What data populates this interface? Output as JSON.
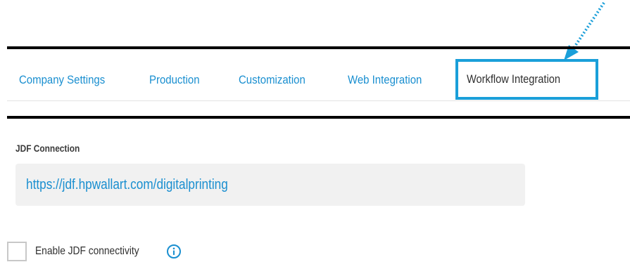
{
  "tabs": [
    {
      "label": "Company Settings",
      "active": false
    },
    {
      "label": "Production",
      "active": false
    },
    {
      "label": "Customization",
      "active": false
    },
    {
      "label": "Web Integration",
      "active": false
    },
    {
      "label": "Workflow Integration",
      "active": true
    }
  ],
  "jdf": {
    "section_label": "JDF Connection",
    "url": "https://jdf.hpwallart.com/digitalprinting"
  },
  "enable_jdf": {
    "label": "Enable JDF connectivity",
    "checked": false,
    "info_icon": "info-icon"
  },
  "colors": {
    "accent": "#1a8fd0",
    "highlight_frame": "#1a9fd9",
    "rule": "#000000",
    "field_bg": "#f1f1f1"
  }
}
